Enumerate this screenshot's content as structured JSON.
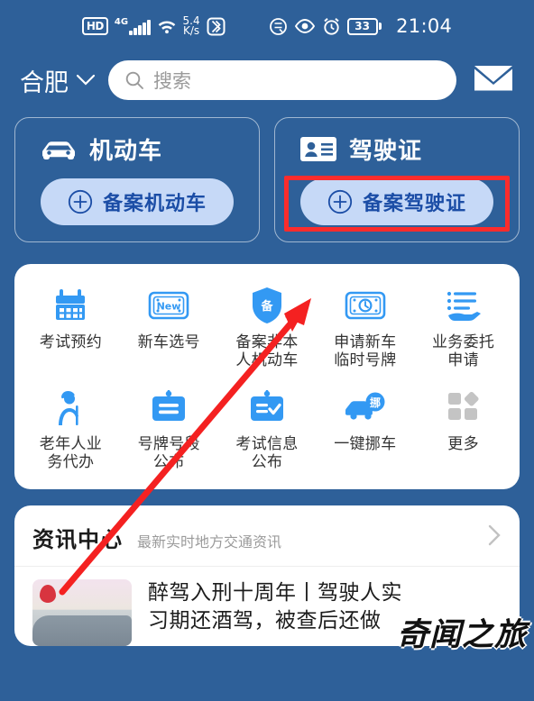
{
  "statusbar": {
    "hd": "HD",
    "network": "4G",
    "speed_value": "5.4",
    "speed_unit": "K/s",
    "battery_level": "33",
    "time": "21:04",
    "icons": [
      "hd-badge-icon",
      "signal-bars-icon",
      "wifi-icon",
      "network-speed-icon",
      "bluetooth-icon",
      "do-not-disturb-icon",
      "eye-comfort-icon",
      "alarm-clock-icon",
      "battery-icon"
    ]
  },
  "header": {
    "city": "合肥",
    "city_chevron": "chevron-down-icon",
    "search_placeholder": "搜索",
    "search_value": "",
    "mail_icon": "mail-icon"
  },
  "cards": [
    {
      "icon": "car-icon",
      "title": "机动车",
      "button_label": "备案机动车",
      "button_icon": "plus-circle-icon",
      "highlighted": false
    },
    {
      "icon": "id-card-icon",
      "title": "驾驶证",
      "button_label": "备案驾驶证",
      "button_icon": "plus-circle-icon",
      "highlighted": true
    }
  ],
  "grid": [
    {
      "icon": "calendar-icon",
      "label": "考试预约"
    },
    {
      "icon": "new-plate-icon",
      "label": "新车选号"
    },
    {
      "icon": "shield-bei-icon",
      "label": "备案非本\n人机动车"
    },
    {
      "icon": "temp-plate-clock-icon",
      "label": "申请新车\n临时号牌"
    },
    {
      "icon": "delegate-hand-icon",
      "label": "业务委托\n申请"
    },
    {
      "icon": "elderly-person-icon",
      "label": "老年人业\n务代办"
    },
    {
      "icon": "plate-number-icon",
      "label": "号牌号段\n公布"
    },
    {
      "icon": "exam-info-icon",
      "label": "考试信息\n公布"
    },
    {
      "icon": "move-car-icon",
      "label": "一键挪车"
    },
    {
      "icon": "more-grid-icon",
      "label": "更多"
    }
  ],
  "news": {
    "title": "资讯中心",
    "subtitle": "最新实时地方交通资讯",
    "more_icon": "chevron-right-icon",
    "items": [
      {
        "thumbnail": "news-thumbnail",
        "headline": "醉驾入刑十周年丨驾驶人实\n习期还酒驾，被查后还做"
      }
    ]
  },
  "watermark": {
    "text": "奇闻之旅"
  },
  "annotations": {
    "highlight_box": {
      "color": "#fb2c2c",
      "target": "备案驾驶证"
    },
    "arrow": {
      "color": "#f42121",
      "points_to": "备案驾驶证"
    }
  },
  "colors": {
    "app_background": "#2e6099",
    "card_button": "#c6d9f7",
    "card_button_text": "#1b4da6",
    "panel_background": "#ffffff",
    "accent_icon_blue": "#3399f3",
    "annotation_red": "#fb2c2c"
  }
}
